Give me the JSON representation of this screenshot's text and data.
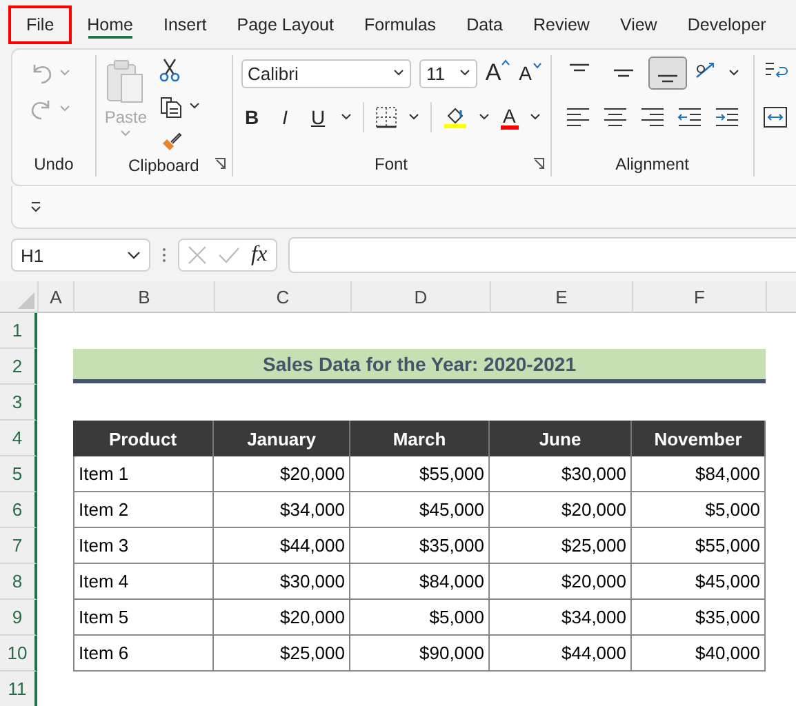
{
  "menu_tabs": [
    {
      "label": "File",
      "selected": false,
      "highlighted": true
    },
    {
      "label": "Home",
      "selected": true,
      "highlighted": false
    },
    {
      "label": "Insert",
      "selected": false,
      "highlighted": false
    },
    {
      "label": "Page Layout",
      "selected": false,
      "highlighted": false
    },
    {
      "label": "Formulas",
      "selected": false,
      "highlighted": false
    },
    {
      "label": "Data",
      "selected": false,
      "highlighted": false
    },
    {
      "label": "Review",
      "selected": false,
      "highlighted": false
    },
    {
      "label": "View",
      "selected": false,
      "highlighted": false
    },
    {
      "label": "Developer",
      "selected": false,
      "highlighted": false
    }
  ],
  "ribbon": {
    "undo": {
      "label": "Undo",
      "disabled": true
    },
    "clipboard": {
      "label": "Clipboard",
      "paste": "Paste",
      "paste_disabled": true
    },
    "font": {
      "label": "Font",
      "font_name": "Calibri",
      "font_size": "11",
      "style_buttons": [
        "B",
        "I",
        "U"
      ],
      "grow": "A",
      "shrink": "A",
      "font_color": "A"
    },
    "alignment": {
      "label": "Alignment",
      "vertical": [
        {
          "kind": "top",
          "selected": false
        },
        {
          "kind": "middle",
          "selected": false
        },
        {
          "kind": "bottom",
          "selected": true
        }
      ]
    }
  },
  "formula_bar": {
    "name_box": "H1",
    "fx": "fx"
  },
  "sheet": {
    "columns": [
      "A",
      "B",
      "C",
      "D",
      "E",
      "F"
    ],
    "rows": [
      "1",
      "2",
      "3",
      "4",
      "5",
      "6",
      "7",
      "8",
      "9",
      "10",
      "11"
    ],
    "title": "Sales Data for the Year: 2020-2021",
    "table": {
      "columns": [
        "Product",
        "January",
        "March",
        "June",
        "November"
      ],
      "rows": [
        [
          "Item 1",
          "$20,000",
          "$55,000",
          "$30,000",
          "$84,000"
        ],
        [
          "Item 2",
          "$34,000",
          "$45,000",
          "$20,000",
          "$5,000"
        ],
        [
          "Item 3",
          "$44,000",
          "$35,000",
          "$25,000",
          "$55,000"
        ],
        [
          "Item 4",
          "$30,000",
          "$84,000",
          "$20,000",
          "$45,000"
        ],
        [
          "Item 5",
          "$20,000",
          "$5,000",
          "$34,000",
          "$35,000"
        ],
        [
          "Item 6",
          "$25,000",
          "$90,000",
          "$44,000",
          "$40,000"
        ]
      ]
    }
  }
}
